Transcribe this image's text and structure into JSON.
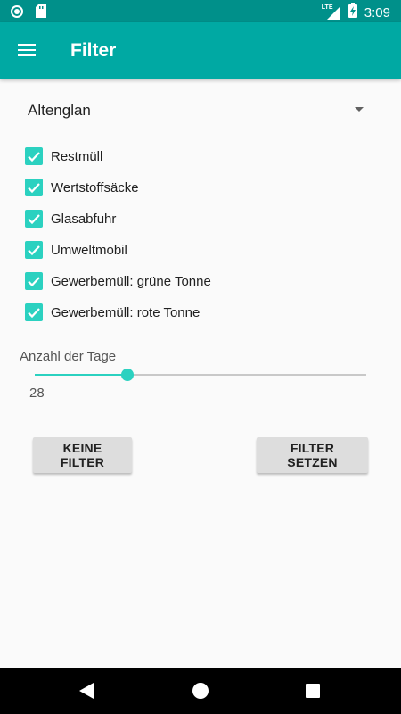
{
  "status_bar": {
    "time": "3:09",
    "network_label": "LTE",
    "icons": [
      "record-icon",
      "sd-card-icon",
      "signal-icon",
      "battery-charging-icon"
    ]
  },
  "app_bar": {
    "title": "Filter",
    "menu_icon": "menu-icon"
  },
  "location_spinner": {
    "selected": "Altenglan"
  },
  "filters": [
    {
      "label": "Restmüll",
      "checked": true
    },
    {
      "label": "Wertstoffsäcke",
      "checked": true
    },
    {
      "label": "Glasabfuhr",
      "checked": true
    },
    {
      "label": "Umweltmobil",
      "checked": true
    },
    {
      "label": "Gewerbemüll: grüne Tonne",
      "checked": true
    },
    {
      "label": "Gewerbemüll: rote Tonne",
      "checked": true
    }
  ],
  "days_slider": {
    "label": "Anzahl der Tage",
    "value_text": "28",
    "fill_fraction": 0.28
  },
  "buttons": {
    "no_filter": "KEINE FILTER",
    "set_filter": "FILTER SETZEN"
  },
  "colors": {
    "status_bar": "#00908a",
    "app_bar": "#00a9a3",
    "accent": "#2bd1c0",
    "background": "#fafafa"
  }
}
